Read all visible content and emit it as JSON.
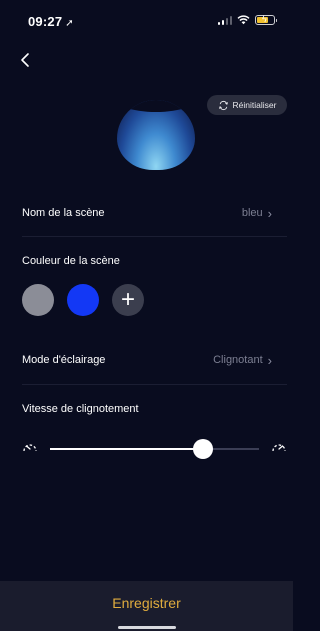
{
  "status_bar": {
    "time": "09:27",
    "location_icon": "location-arrow-icon",
    "signal_icon": "cellular-signal-icon",
    "wifi_icon": "wifi-icon",
    "battery_icon": "battery-charging-icon",
    "battery_color": "#f2c230"
  },
  "header": {
    "back_icon": "chevron-left-icon"
  },
  "reset_button": {
    "label": "Réinitialiser",
    "icon": "reset-icon"
  },
  "scene_name": {
    "label": "Nom de la scène",
    "value": "bleu"
  },
  "scene_color": {
    "label": "Couleur de la scène",
    "swatches": [
      "#8b8d97",
      "#1338f5"
    ],
    "add_label": "+"
  },
  "lighting_mode": {
    "label": "Mode d'éclairage",
    "value": "Clignotant"
  },
  "blink_speed": {
    "label": "Vitesse de clignotement",
    "level": 0.73,
    "slow_icon": "speed-slow-icon",
    "fast_icon": "speed-fast-icon"
  },
  "footer": {
    "save_label": "Enregistrer",
    "accent_color": "#e0ac3e"
  }
}
